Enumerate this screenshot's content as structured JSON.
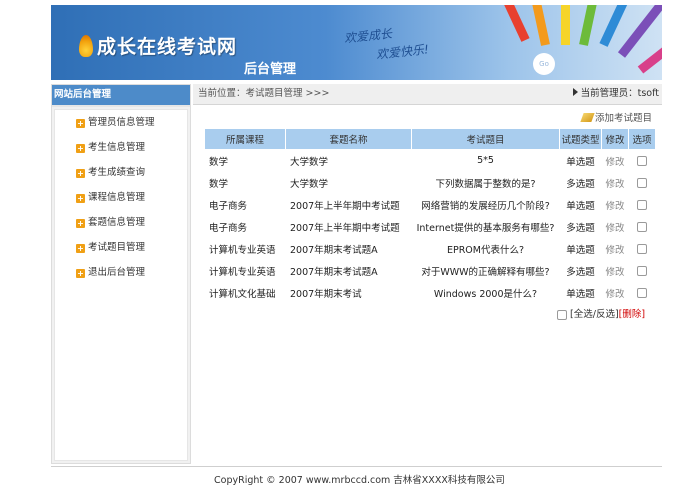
{
  "header": {
    "logo_text": "成长在线考试网",
    "subtitle": "后台管理",
    "slogan_line1": "欢爱成长",
    "slogan_line2": "欢爱快乐!",
    "badge": "Go"
  },
  "sidebar": {
    "title": "网站后台管理",
    "icon": "plus-square-icon",
    "items": [
      {
        "label": "管理员信息管理"
      },
      {
        "label": "考生信息管理"
      },
      {
        "label": "考生成绩查询"
      },
      {
        "label": "课程信息管理"
      },
      {
        "label": "套题信息管理"
      },
      {
        "label": "考试题目管理"
      },
      {
        "label": "退出后台管理"
      }
    ]
  },
  "breadcrumb": {
    "location": "当前位置：考试题目管理 >>>",
    "admin": "当前管理员：tsoft"
  },
  "actions": {
    "add_question": "添加考试题目",
    "select_toggle": "[全选/反选]",
    "delete_label": "[删除]"
  },
  "table": {
    "headers": [
      "所属课程",
      "套题名称",
      "考试题目",
      "试题类型",
      "修改",
      "选项"
    ],
    "rows": [
      {
        "course": "数学",
        "set": "大学数学",
        "question": "5*5",
        "type": "单选题",
        "edit": "修改"
      },
      {
        "course": "数学",
        "set": "大学数学",
        "question": "下列数据属于整数的是?",
        "type": "多选题",
        "edit": "修改"
      },
      {
        "course": "电子商务",
        "set": "2007年上半年期中考试题",
        "question": "网络营销的发展经历几个阶段?",
        "type": "单选题",
        "edit": "修改"
      },
      {
        "course": "电子商务",
        "set": "2007年上半年期中考试题",
        "question": "Internet提供的基本服务有哪些?",
        "type": "多选题",
        "edit": "修改"
      },
      {
        "course": "计算机专业英语",
        "set": "2007年期末考试题A",
        "question": "EPROM代表什么?",
        "type": "单选题",
        "edit": "修改"
      },
      {
        "course": "计算机专业英语",
        "set": "2007年期末考试题A",
        "question": "对于WWW的正确解释有哪些?",
        "type": "多选题",
        "edit": "修改"
      },
      {
        "course": "计算机文化基础",
        "set": "2007年期末考试",
        "question": "Windows 2000是什么?",
        "type": "单选题",
        "edit": "修改"
      }
    ]
  },
  "footer": {
    "copyright": "CopyRight © 2007 www.mrbccd.com 吉林省XXXX科技有限公司"
  },
  "colors": {
    "sidebar_head": "#4d8bc9",
    "table_header": "#a9cdee",
    "delete_link": "#d10000"
  }
}
